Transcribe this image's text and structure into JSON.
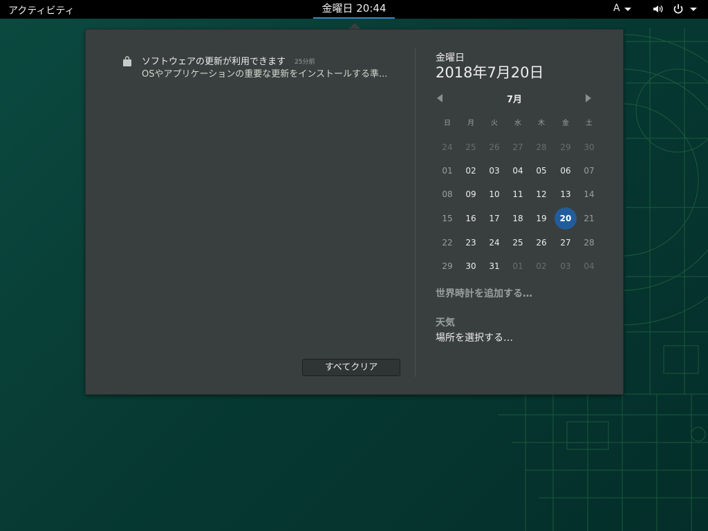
{
  "topbar": {
    "activities": "アクティビティ",
    "clock": "金曜日 20:44",
    "input_method": "A"
  },
  "notification": {
    "title": "ソフトウェアの更新が利用できます",
    "time": "25分前",
    "body": "OSやアプリケーションの重要な更新をインストールする準..."
  },
  "clear_all": "すべてクリア",
  "date_header": {
    "day_name": "金曜日",
    "full_date": "2018年7月20日"
  },
  "calendar": {
    "month": "7月",
    "weekdays": [
      "日",
      "月",
      "火",
      "水",
      "木",
      "金",
      "土"
    ],
    "weeks": [
      [
        "24",
        "25",
        "26",
        "27",
        "28",
        "29",
        "30"
      ],
      [
        "01",
        "02",
        "03",
        "04",
        "05",
        "06",
        "07"
      ],
      [
        "08",
        "09",
        "10",
        "11",
        "12",
        "13",
        "14"
      ],
      [
        "15",
        "16",
        "17",
        "18",
        "19",
        "20",
        "21"
      ],
      [
        "22",
        "23",
        "24",
        "25",
        "26",
        "27",
        "28"
      ],
      [
        "29",
        "30",
        "31",
        "01",
        "02",
        "03",
        "04"
      ]
    ],
    "today": "20"
  },
  "world_clock_label": "世界時計を追加する…",
  "weather": {
    "title": "天気",
    "location": "場所を選択する…"
  },
  "colors": {
    "accent": "#215d9c",
    "clock_underline": "#3d85c6",
    "popup_bg": "#393f3f"
  },
  "icons": [
    "shopping-bag-icon",
    "speaker-icon",
    "power-icon",
    "chevron-down-icon"
  ]
}
